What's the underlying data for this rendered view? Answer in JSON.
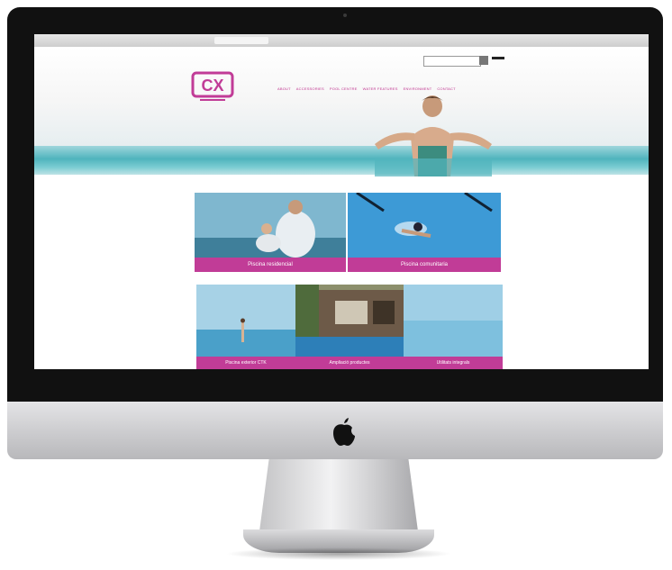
{
  "imac": {
    "logo_icon": "apple-icon"
  },
  "browser": {
    "tab_title": ""
  },
  "site": {
    "logo_text": "CX",
    "logo_subtext": "",
    "search": {
      "placeholder": "",
      "button_icon": "search-icon"
    },
    "lang_link": "",
    "accent_color": "#c13c97",
    "nav": [
      {
        "label": "ABOUT"
      },
      {
        "label": "ACCESSORIES"
      },
      {
        "label": "POOL CENTRE"
      },
      {
        "label": "WATER FEATURES"
      },
      {
        "label": "ENVIRONMENT"
      },
      {
        "label": "CONTACT"
      }
    ],
    "tiles": [
      {
        "label": "Piscina residencial"
      },
      {
        "label": "Piscina comunitaria"
      },
      {
        "label": "Piscina exterior CTK"
      },
      {
        "label": "Ampliació productes"
      },
      {
        "label": "Utilitats integrals"
      }
    ]
  }
}
